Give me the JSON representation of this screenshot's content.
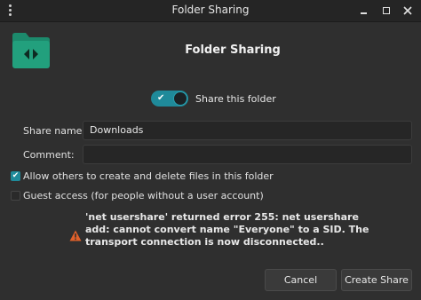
{
  "window": {
    "title": "Folder Sharing"
  },
  "header": {
    "icon": "folder-share-icon",
    "title": "Folder Sharing"
  },
  "share_toggle": {
    "label": "Share this folder",
    "on": true,
    "accent": "#1f8a9a"
  },
  "fields": {
    "share_name_label": "Share name:",
    "share_name_value": "Downloads",
    "comment_label": "Comment:",
    "comment_value": ""
  },
  "options": {
    "allow_others_label": "Allow others to create and delete files in this folder",
    "allow_others_checked": true,
    "guest_label": "Guest access (for people without a user account)",
    "guest_checked": false
  },
  "error": {
    "icon": "warning-icon",
    "color": "#e0602a",
    "message": "'net usershare' returned error 255: net usershare add: cannot convert name \"Everyone\" to a SID. The transport connection is now disconnected.."
  },
  "buttons": {
    "cancel": "Cancel",
    "create": "Create Share"
  }
}
